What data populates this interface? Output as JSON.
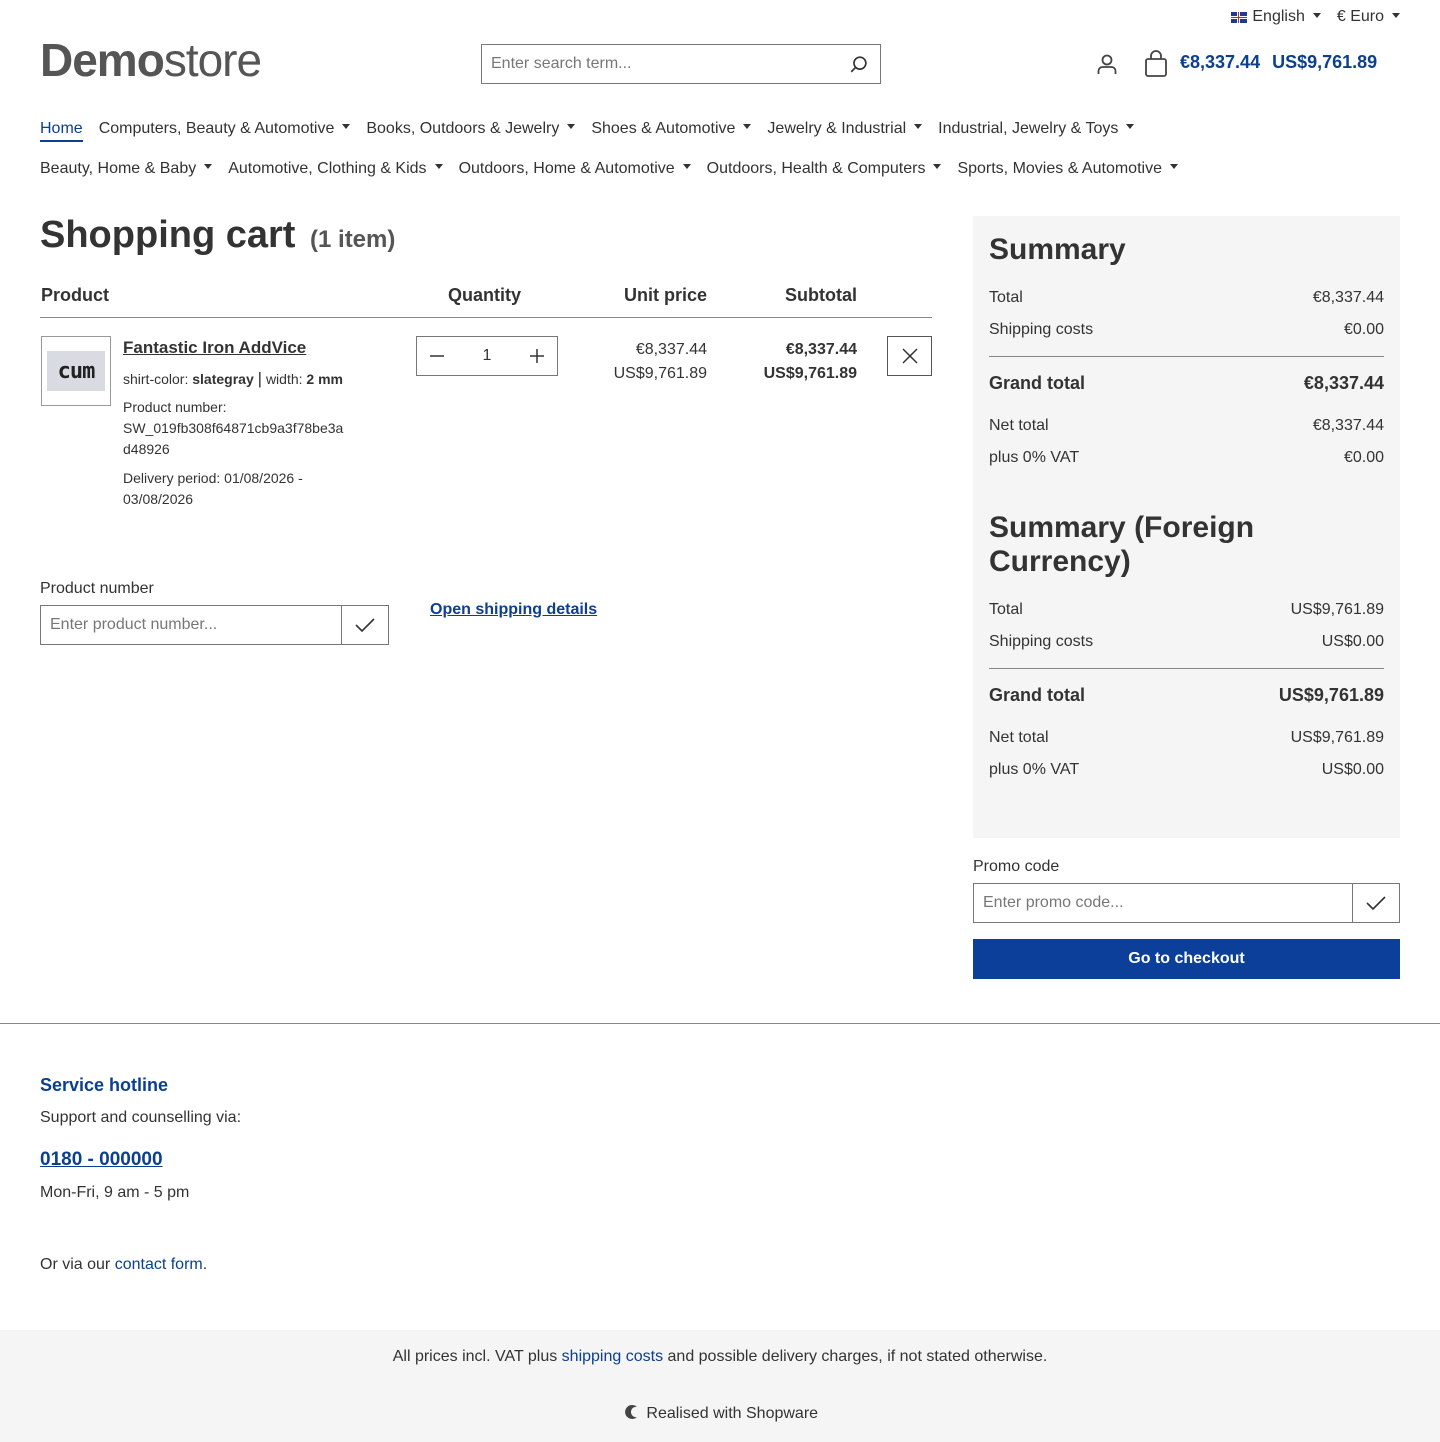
{
  "topbar": {
    "language": "English",
    "currency": "€ Euro"
  },
  "header": {
    "logo_bold": "Demo",
    "logo_light": "store",
    "search_placeholder": "Enter search term...",
    "cart_total_eur": "€8,337.44",
    "cart_total_usd": "US$9,761.89"
  },
  "nav": {
    "row1": [
      "Home",
      "Computers, Beauty & Automotive",
      "Books, Outdoors & Jewelry",
      "Shoes & Automotive",
      "Jewelry & Industrial",
      "Industrial, Jewelry & Toys"
    ],
    "row2": [
      "Beauty, Home & Baby",
      "Automotive, Clothing & Kids",
      "Outdoors, Home & Automotive",
      "Outdoors, Health & Computers",
      "Sports, Movies & Automotive"
    ]
  },
  "cart": {
    "title": "Shopping cart",
    "count": "(1 item)",
    "columns": {
      "product": "Product",
      "quantity": "Quantity",
      "unit_price": "Unit price",
      "subtotal": "Subtotal"
    },
    "item": {
      "thumb_text": "cum",
      "name": "Fantastic Iron AddVice",
      "opt1_label": "shirt-color:",
      "opt1_value": "slategray",
      "opt_sep": "|",
      "opt2_label": "width:",
      "opt2_value": "2 mm",
      "product_number_label": "Product number:",
      "product_number_line1": "SW_019fb308f64871cb9a3f78be3a",
      "product_number_line2": "d48926",
      "delivery_line1": "Delivery period: 01/08/2026 -",
      "delivery_line2": "03/08/2026",
      "quantity": "1",
      "unit_eur": "€8,337.44",
      "unit_usd": "US$9,761.89",
      "sub_eur": "€8,337.44",
      "sub_usd": "US$9,761.89"
    },
    "product_number_label": "Product number",
    "product_number_placeholder": "Enter product number...",
    "shipping_link": "Open shipping details"
  },
  "summary": {
    "title": "Summary",
    "total_label": "Total",
    "total": "€8,337.44",
    "shipping_label": "Shipping costs",
    "shipping": "€0.00",
    "grand_label": "Grand total",
    "grand": "€8,337.44",
    "net_label": "Net total",
    "net": "€8,337.44",
    "vat_label": "plus 0% VAT",
    "vat": "€0.00",
    "foreign_title_line1": "Summary (Foreign",
    "foreign_title_line2": "Currency)",
    "f_total": "US$9,761.89",
    "f_shipping": "US$0.00",
    "f_grand": "US$9,761.89",
    "f_net": "US$9,761.89",
    "f_vat": "US$0.00"
  },
  "promo": {
    "label": "Promo code",
    "placeholder": "Enter promo code...",
    "checkout": "Go to checkout"
  },
  "footer": {
    "hotline_title": "Service hotline",
    "support": "Support and counselling via:",
    "phone": "0180 - 000000",
    "hours": "Mon-Fri, 9 am - 5 pm",
    "contact_pre": "Or via our",
    "contact_link": "contact form",
    "contact_post": ".",
    "vat_pre": "All prices incl. VAT plus",
    "vat_link": "shipping costs",
    "vat_post": "and possible delivery charges, if not stated otherwise.",
    "powered": "Realised with Shopware"
  },
  "colors": {
    "accent": "#0b3f8f",
    "checkout": "#0b3f9a",
    "summary_bg": "#f5f5f5"
  }
}
